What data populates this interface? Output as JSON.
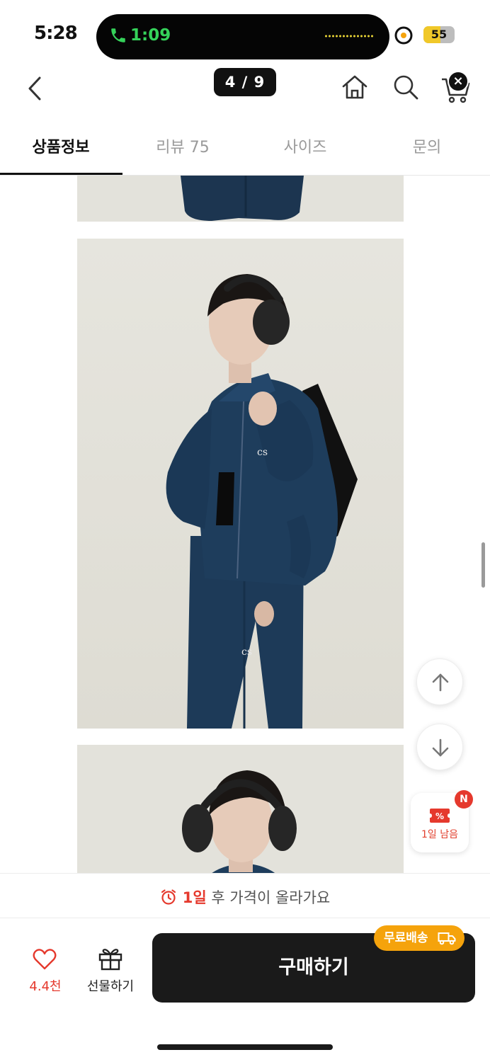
{
  "status_bar": {
    "time": "5:28",
    "call_time": "1:09",
    "battery": "55"
  },
  "nav": {
    "page_counter": "4 / 9",
    "back_icon": "chevron-left-icon",
    "home_icon": "home-icon",
    "search_icon": "search-icon",
    "cart_icon": "cart-icon",
    "close_symbol": "×"
  },
  "tabs": [
    {
      "label": "상품정보",
      "active": true
    },
    {
      "label": "리뷰 75",
      "active": false
    },
    {
      "label": "사이즈",
      "active": false
    },
    {
      "label": "문의",
      "active": false
    }
  ],
  "floating": {
    "coupon_label": "1일 남음",
    "coupon_badge": "N",
    "coupon_symbol": "%"
  },
  "notice": {
    "day": "1일",
    "text": " 후 가격이 올라가요"
  },
  "bottom": {
    "like_count": "4.4천",
    "gift_label": "선물하기",
    "buy_label": "구매하기",
    "free_shipping": "무료배송"
  },
  "colors": {
    "accent_red": "#e5392d",
    "shipping_orange": "#f5a30c",
    "buy_button": "#1a1a1a",
    "call_green": "#35d25a"
  }
}
